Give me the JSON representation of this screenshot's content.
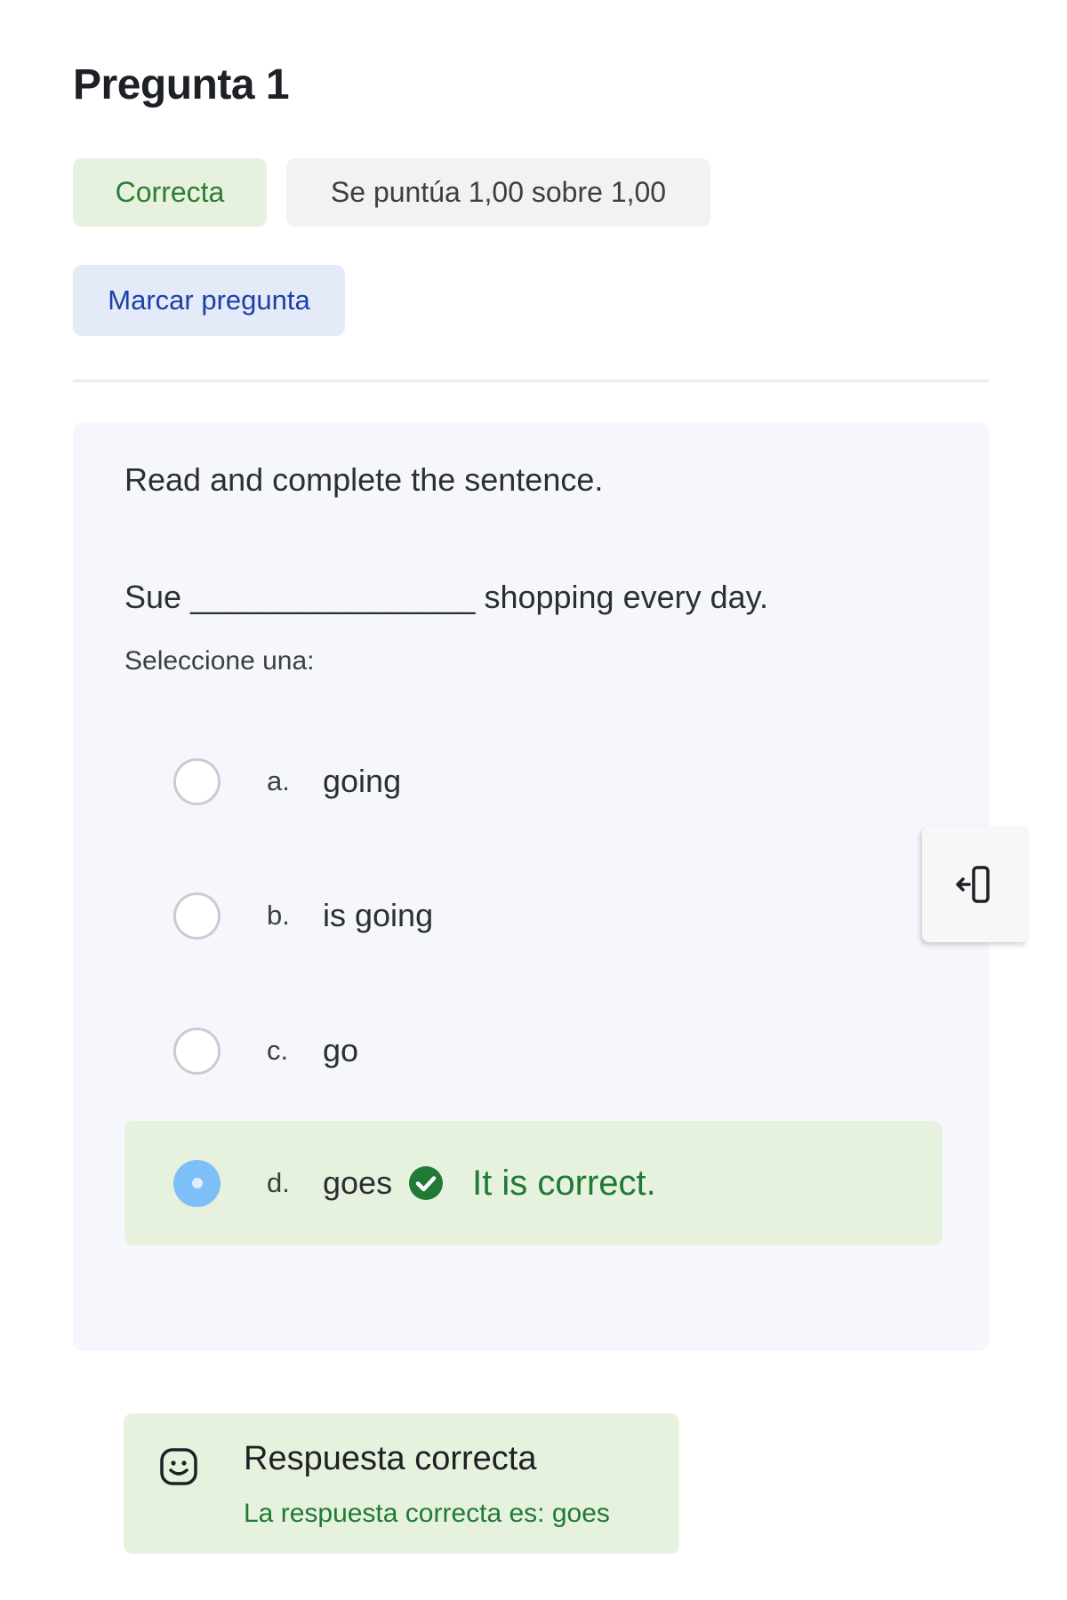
{
  "question": {
    "title": "Pregunta 1",
    "status_badge": "Correcta",
    "grade_text": "Se puntúa 1,00 sobre 1,00",
    "flag_label": "Marcar pregunta"
  },
  "content": {
    "instruction": "Read and complete the sentence.",
    "sentence_start": "Sue",
    "sentence_blank": "________________",
    "sentence_end": "shopping every day.",
    "select_prompt": "Seleccione una:"
  },
  "options": [
    {
      "letter": "a.",
      "text": "going",
      "selected": false
    },
    {
      "letter": "b.",
      "text": "is going",
      "selected": false
    },
    {
      "letter": "c.",
      "text": "go",
      "selected": false
    },
    {
      "letter": "d.",
      "text": "goes",
      "selected": true,
      "feedback": "It is correct."
    }
  ],
  "answer": {
    "title": "Respuesta correcta",
    "detail": "La respuesta correcta es: goes"
  },
  "icons": {
    "check": "check-circle-icon",
    "smile": "smile-icon",
    "side_tab": "drawer-toggle-icon"
  },
  "colors": {
    "correct_bg": "#e6f2de",
    "correct_text": "#2e7d32",
    "flag_bg": "#e4eaf8",
    "flag_text": "#1c3fa8",
    "selected_radio": "#7cc0f7"
  }
}
